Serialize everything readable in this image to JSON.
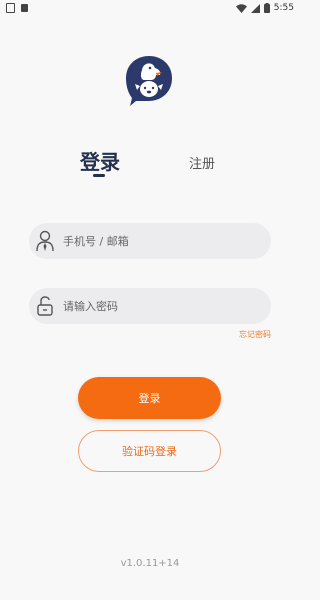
{
  "status_bar": {
    "time": "5:55",
    "icons": [
      "notification-square-icon",
      "app-a-icon",
      "wifi-icon",
      "signal-icon",
      "battery-icon"
    ]
  },
  "logo": {
    "icon": "penguin-bird-logo",
    "color": "#2b3a6b"
  },
  "tabs": {
    "login": "登录",
    "register": "注册"
  },
  "form": {
    "account_placeholder": "手机号 / 邮箱",
    "password_placeholder": "请输入密码",
    "forgot_password": "忘记密码"
  },
  "buttons": {
    "login": "登录",
    "code_login": "验证码登录"
  },
  "version": "v1.0.11+14",
  "colors": {
    "accent": "#f46b12",
    "primary_text": "#24304d",
    "field_bg": "#ececef"
  }
}
